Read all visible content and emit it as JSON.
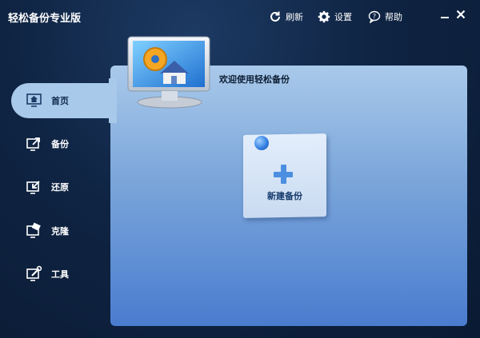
{
  "window": {
    "title": "轻松备份专业版"
  },
  "toolbar": {
    "refresh_label": "刷新",
    "settings_label": "设置",
    "help_label": "帮助"
  },
  "sidebar": {
    "items": [
      {
        "label": "首页",
        "icon": "home-icon",
        "active": true
      },
      {
        "label": "备份",
        "icon": "backup-icon",
        "active": false
      },
      {
        "label": "还原",
        "icon": "restore-icon",
        "active": false
      },
      {
        "label": "克隆",
        "icon": "clone-icon",
        "active": false
      },
      {
        "label": "工具",
        "icon": "tools-icon",
        "active": false
      }
    ]
  },
  "main": {
    "welcome_text": "欢迎使用轻松备份",
    "new_backup_label": "新建备份"
  },
  "colors": {
    "accent": "#4c8fe0",
    "panel_top": "#a9c9ea",
    "panel_bottom": "#4a7ccf",
    "background": "#0f2443"
  }
}
